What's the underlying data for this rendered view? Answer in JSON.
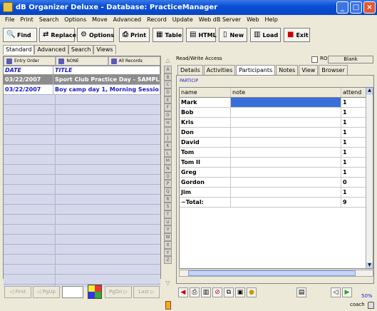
{
  "window": {
    "title": "dB Organizer Deluxe - Database: PracticeManager"
  },
  "menu": [
    "File",
    "Print",
    "Search",
    "Options",
    "Move",
    "Advanced",
    "Record",
    "Update",
    "Web dB Server",
    "Web",
    "Help"
  ],
  "toolbar": [
    {
      "label": "Find",
      "icon": "find-icon"
    },
    {
      "label": "Replace",
      "icon": "replace-icon"
    },
    {
      "label": "Options",
      "icon": "options-icon"
    },
    {
      "label": "Print",
      "icon": "print-icon"
    },
    {
      "label": "Table",
      "icon": "table-icon"
    },
    {
      "label": "HTML",
      "icon": "html-icon"
    },
    {
      "label": "New",
      "icon": "new-icon"
    },
    {
      "label": "Load",
      "icon": "load-icon"
    },
    {
      "label": "Exit",
      "icon": "exit-icon"
    }
  ],
  "subtabs": [
    "Standard",
    "Advanced",
    "Search",
    "Views"
  ],
  "sort": [
    "Entry Order",
    "NONE",
    "All Records"
  ],
  "list": {
    "headers": [
      "DATE",
      "TITLE"
    ],
    "rows": [
      {
        "date": "03/22/2007",
        "title": "Sport Club Practice Day - SAMPL"
      },
      {
        "date": "03/22/2007",
        "title": "Boy camp day 1, Morning Sessio"
      }
    ]
  },
  "nav": [
    "First",
    "PgUp",
    "PgDn",
    "Last"
  ],
  "alphabet": [
    "A",
    "B",
    "C",
    "D",
    "E",
    "F",
    "G",
    "H",
    "I",
    "J",
    "K",
    "L",
    "M",
    "N",
    "O",
    "P",
    "Q",
    "R",
    "S",
    "T",
    "U",
    "V",
    "W",
    "X",
    "Y",
    "Z"
  ],
  "access": "Read/Write Access",
  "ro_label": "RO",
  "blank_label": "Blank",
  "rtabs": [
    "Details",
    "Activities",
    "Participants",
    "Notes",
    "View",
    "Browser"
  ],
  "particip_label": "PARTICIP",
  "participants": {
    "headers": [
      "name",
      "note",
      "attend"
    ],
    "rows": [
      {
        "name": "Mark",
        "note": "",
        "attend": "1"
      },
      {
        "name": "Bob",
        "note": "",
        "attend": "1"
      },
      {
        "name": "Kris",
        "note": "",
        "attend": "1"
      },
      {
        "name": "Don",
        "note": "",
        "attend": "1"
      },
      {
        "name": "David",
        "note": "",
        "attend": "1"
      },
      {
        "name": "Tom",
        "note": "",
        "attend": "1"
      },
      {
        "name": "Tom II",
        "note": "",
        "attend": "1"
      },
      {
        "name": "Greg",
        "note": "",
        "attend": "1"
      },
      {
        "name": "Gordon",
        "note": "",
        "attend": "0"
      },
      {
        "name": "Jim",
        "note": "",
        "attend": "1"
      },
      {
        "name": "~Total:",
        "note": "",
        "attend": "9"
      }
    ]
  },
  "zoom": "50%",
  "user": "coach"
}
